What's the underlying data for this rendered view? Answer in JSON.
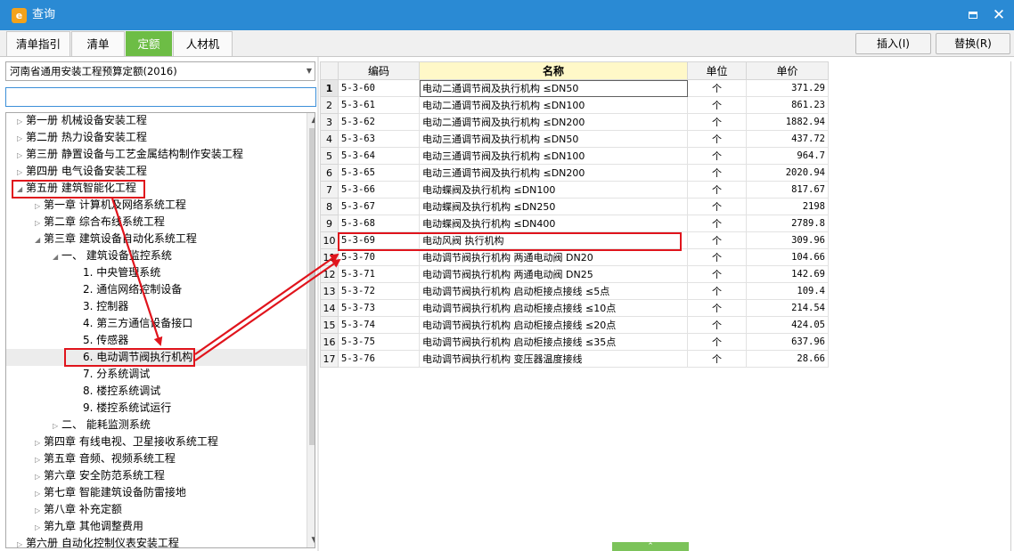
{
  "window": {
    "title": "查询",
    "app_icon": "app-logo-icon",
    "max_icon": "maximize-icon",
    "close_glyph": "✕"
  },
  "tabs": [
    {
      "label": "清单指引",
      "active": false
    },
    {
      "label": "清单",
      "active": false
    },
    {
      "label": "定额",
      "active": true
    },
    {
      "label": "人材机",
      "active": false
    }
  ],
  "actions": {
    "insert_label": "插入(I)",
    "replace_label": "替换(R)"
  },
  "quota_library": {
    "selected": "河南省通用安装工程预算定额(2016)",
    "search_value": ""
  },
  "tree": [
    {
      "label": "第一册 机械设备安装工程",
      "level": 0,
      "expander": "collapsed"
    },
    {
      "label": "第二册 热力设备安装工程",
      "level": 0,
      "expander": "collapsed"
    },
    {
      "label": "第三册 静置设备与工艺金属结构制作安装工程",
      "level": 0,
      "expander": "collapsed"
    },
    {
      "label": "第四册 电气设备安装工程",
      "level": 0,
      "expander": "collapsed"
    },
    {
      "label": "第五册 建筑智能化工程",
      "level": 0,
      "expander": "expanded",
      "highlighted": true
    },
    {
      "label": "第一章 计算机及网络系统工程",
      "level": 1,
      "expander": "collapsed"
    },
    {
      "label": "第二章 综合布线系统工程",
      "level": 1,
      "expander": "collapsed"
    },
    {
      "label": "第三章 建筑设备自动化系统工程",
      "level": 1,
      "expander": "expanded"
    },
    {
      "label": "一、 建筑设备监控系统",
      "level": 2,
      "expander": "expanded"
    },
    {
      "label": "1. 中央管理系统",
      "level": 3,
      "expander": "none"
    },
    {
      "label": "2. 通信网络控制设备",
      "level": 3,
      "expander": "none"
    },
    {
      "label": "3. 控制器",
      "level": 3,
      "expander": "none"
    },
    {
      "label": "4. 第三方通信设备接口",
      "level": 3,
      "expander": "none"
    },
    {
      "label": "5. 传感器",
      "level": 3,
      "expander": "none"
    },
    {
      "label": "6. 电动调节阀执行机构",
      "level": 3,
      "expander": "none",
      "selected": true,
      "highlighted": true
    },
    {
      "label": "7. 分系统调试",
      "level": 3,
      "expander": "none"
    },
    {
      "label": "8. 楼控系统调试",
      "level": 3,
      "expander": "none"
    },
    {
      "label": "9. 楼控系统试运行",
      "level": 3,
      "expander": "none"
    },
    {
      "label": "二、 能耗监测系统",
      "level": 2,
      "expander": "collapsed"
    },
    {
      "label": "第四章 有线电视、卫星接收系统工程",
      "level": 1,
      "expander": "collapsed"
    },
    {
      "label": "第五章 音频、视频系统工程",
      "level": 1,
      "expander": "collapsed"
    },
    {
      "label": "第六章 安全防范系统工程",
      "level": 1,
      "expander": "collapsed"
    },
    {
      "label": "第七章 智能建筑设备防雷接地",
      "level": 1,
      "expander": "collapsed"
    },
    {
      "label": "第八章 补充定额",
      "level": 1,
      "expander": "collapsed"
    },
    {
      "label": "第九章 其他调整费用",
      "level": 1,
      "expander": "collapsed"
    },
    {
      "label": "第六册 自动化控制仪表安装工程",
      "level": 0,
      "expander": "collapsed"
    }
  ],
  "grid": {
    "columns": [
      "编码",
      "名称",
      "单位",
      "单价"
    ],
    "rows": [
      {
        "no": "1",
        "code": "5-3-60",
        "name": "电动二通调节阀及执行机构 ≤DN50",
        "unit": "个",
        "price": "371.29"
      },
      {
        "no": "2",
        "code": "5-3-61",
        "name": "电动二通调节阀及执行机构 ≤DN100",
        "unit": "个",
        "price": "861.23"
      },
      {
        "no": "3",
        "code": "5-3-62",
        "name": "电动二通调节阀及执行机构 ≤DN200",
        "unit": "个",
        "price": "1882.94"
      },
      {
        "no": "4",
        "code": "5-3-63",
        "name": "电动三通调节阀及执行机构 ≤DN50",
        "unit": "个",
        "price": "437.72"
      },
      {
        "no": "5",
        "code": "5-3-64",
        "name": "电动三通调节阀及执行机构 ≤DN100",
        "unit": "个",
        "price": "964.7"
      },
      {
        "no": "6",
        "code": "5-3-65",
        "name": "电动三通调节阀及执行机构 ≤DN200",
        "unit": "个",
        "price": "2020.94"
      },
      {
        "no": "7",
        "code": "5-3-66",
        "name": "电动蝶阀及执行机构 ≤DN100",
        "unit": "个",
        "price": "817.67"
      },
      {
        "no": "8",
        "code": "5-3-67",
        "name": "电动蝶阀及执行机构 ≤DN250",
        "unit": "个",
        "price": "2198"
      },
      {
        "no": "9",
        "code": "5-3-68",
        "name": "电动蝶阀及执行机构 ≤DN400",
        "unit": "个",
        "price": "2789.8"
      },
      {
        "no": "10",
        "code": "5-3-69",
        "name": "电动风阀 执行机构",
        "unit": "个",
        "price": "309.96",
        "highlighted": true
      },
      {
        "no": "11",
        "code": "5-3-70",
        "name": "电动调节阀执行机构 两通电动阀 DN20",
        "unit": "个",
        "price": "104.66"
      },
      {
        "no": "12",
        "code": "5-3-71",
        "name": "电动调节阀执行机构 两通电动阀 DN25",
        "unit": "个",
        "price": "142.69"
      },
      {
        "no": "13",
        "code": "5-3-72",
        "name": "电动调节阀执行机构 启动柜接点接线 ≤5点",
        "unit": "个",
        "price": "109.4"
      },
      {
        "no": "14",
        "code": "5-3-73",
        "name": "电动调节阀执行机构 启动柜接点接线 ≤10点",
        "unit": "个",
        "price": "214.54"
      },
      {
        "no": "15",
        "code": "5-3-74",
        "name": "电动调节阀执行机构 启动柜接点接线 ≤20点",
        "unit": "个",
        "price": "424.05"
      },
      {
        "no": "16",
        "code": "5-3-75",
        "name": "电动调节阀执行机构 启动柜接点接线 ≤35点",
        "unit": "个",
        "price": "637.96"
      },
      {
        "no": "17",
        "code": "5-3-76",
        "name": "电动调节阀执行机构 变压器温度接线",
        "unit": "个",
        "price": "28.66"
      }
    ]
  },
  "annotation": {
    "color": "#e0141c",
    "arrows": [
      "tree-book-5-to-tree-item-6",
      "tree-item-6-to-grid-row-10",
      "tree-item-6-to-grid-row-11"
    ]
  },
  "bottom_handle_icon": "collapse-up-icon"
}
